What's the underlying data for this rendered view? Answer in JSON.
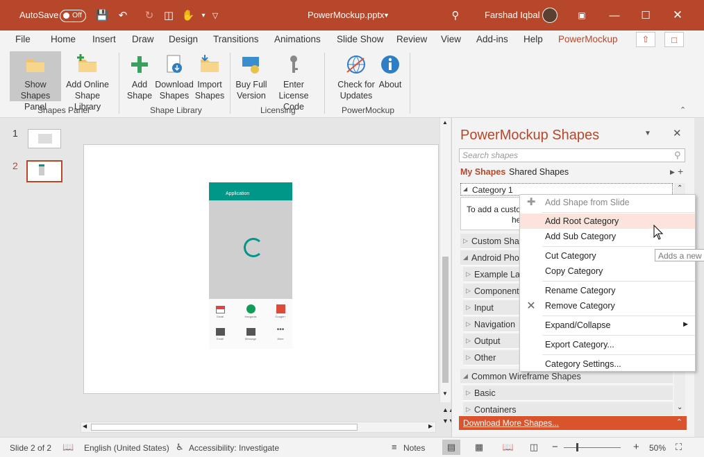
{
  "titlebar": {
    "autosave_label": "AutoSave",
    "autosave_state": "Off",
    "filename": "PowerMockup.pptx",
    "user": "Farshad Iqbal"
  },
  "menu": [
    "File",
    "Home",
    "Insert",
    "Draw",
    "Design",
    "Transitions",
    "Animations",
    "Slide Show",
    "Review",
    "View",
    "Add-ins",
    "Help",
    "PowerMockup"
  ],
  "ribbon": {
    "buttons": {
      "show_panel": [
        "Show",
        "Shapes Panel"
      ],
      "add_online": [
        "Add Online",
        "Shape Library"
      ],
      "add_shape": [
        "Add",
        "Shape"
      ],
      "download_shapes": [
        "Download",
        "Shapes"
      ],
      "import_shapes": [
        "Import",
        "Shapes"
      ],
      "buy_full": [
        "Buy Full",
        "Version"
      ],
      "enter_license": [
        "Enter License",
        "Code"
      ],
      "check_updates": [
        "Check for",
        "Updates"
      ],
      "about": [
        "About"
      ]
    },
    "groups": [
      "Shapes Panel",
      "Shape Library",
      "Licensing",
      "PowerMockup"
    ]
  },
  "thumbnails": [
    "1",
    "2"
  ],
  "slide": {
    "app_title": "Application",
    "apps": [
      "Gmail",
      "Hangouts",
      "Google+",
      "Email",
      "Message",
      "More"
    ]
  },
  "pane": {
    "title": "PowerMockup Shapes",
    "search_placeholder": "Search shapes",
    "tabs": [
      "My Shapes",
      "Shared Shapes"
    ],
    "category1": "Category 1",
    "category1_msg": [
      "To add a custo",
      "he"
    ],
    "tree": [
      {
        "label": "Custom Shape",
        "level": 0
      },
      {
        "label": "Android Phon",
        "level": 0,
        "open": true
      },
      {
        "label": "Example Lay",
        "level": 1
      },
      {
        "label": "Components",
        "level": 1
      },
      {
        "label": "Input",
        "level": 1
      },
      {
        "label": "Navigation",
        "level": 1
      },
      {
        "label": "Output",
        "level": 1
      },
      {
        "label": "Other",
        "level": 1
      },
      {
        "label": "Common Wireframe Shapes",
        "level": 0,
        "open": true
      },
      {
        "label": "Basic",
        "level": 1
      },
      {
        "label": "Containers",
        "level": 1
      }
    ],
    "download_link": "Download More Shapes..."
  },
  "context_menu": [
    {
      "label": "Add Shape from Slide",
      "disabled": true,
      "icon": "plus-icon"
    },
    {
      "label": "Add Root Category",
      "hover": true
    },
    {
      "label": "Add Sub Category"
    },
    {
      "label": "Cut Category"
    },
    {
      "label": "Copy Category"
    },
    {
      "label": "Rename Category"
    },
    {
      "label": "Remove Category",
      "icon": "x-icon"
    },
    {
      "label": "Expand/Collapse",
      "submenu": true
    },
    {
      "label": "Export Category..."
    },
    {
      "label": "Category Settings..."
    }
  ],
  "tooltip": "Adds a new",
  "status": {
    "slide": "Slide 2 of 2",
    "language": "English (United States)",
    "accessibility": "Accessibility: Investigate",
    "notes": "Notes",
    "zoom": "50%"
  },
  "colors": {
    "accent": "#b7472a",
    "teal": "#009688",
    "download_bar": "#d9532c"
  }
}
